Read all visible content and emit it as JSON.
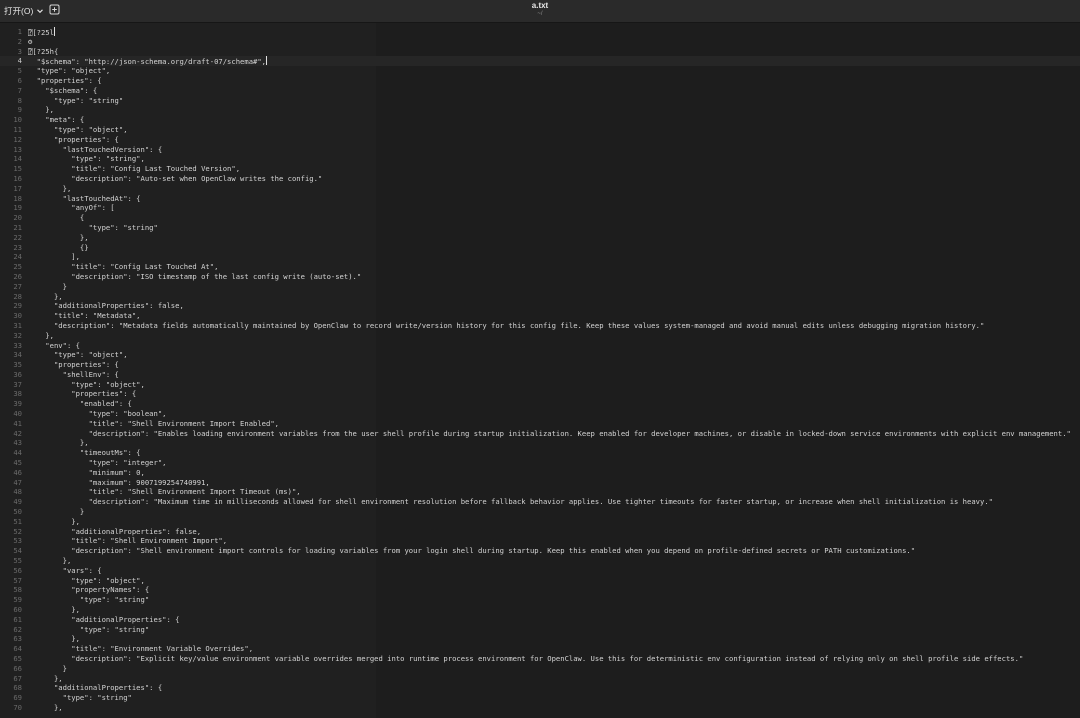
{
  "titlebar": {
    "open_label": "打开(O)",
    "title": "a.txt",
    "subtitle": "~/"
  },
  "icons": {
    "open_menu": "chevron-down-icon",
    "new_tab": "new-tab-icon"
  },
  "editor": {
    "current_line": 4,
    "lines": [
      "⍰[?25l",
      "⚙",
      "⍰[?25h{",
      "  \"$schema\": \"http://json-schema.org/draft-07/schema#\",",
      "  \"type\": \"object\",",
      "  \"properties\": {",
      "    \"$schema\": {",
      "      \"type\": \"string\"",
      "    },",
      "    \"meta\": {",
      "      \"type\": \"object\",",
      "      \"properties\": {",
      "        \"lastTouchedVersion\": {",
      "          \"type\": \"string\",",
      "          \"title\": \"Config Last Touched Version\",",
      "          \"description\": \"Auto-set when OpenClaw writes the config.\"",
      "        },",
      "        \"lastTouchedAt\": {",
      "          \"anyOf\": [",
      "            {",
      "              \"type\": \"string\"",
      "            },",
      "            {}",
      "          ],",
      "          \"title\": \"Config Last Touched At\",",
      "          \"description\": \"ISO timestamp of the last config write (auto-set).\"",
      "        }",
      "      },",
      "      \"additionalProperties\": false,",
      "      \"title\": \"Metadata\",",
      "      \"description\": \"Metadata fields automatically maintained by OpenClaw to record write/version history for this config file. Keep these values system-managed and avoid manual edits unless debugging migration history.\"",
      "    },",
      "    \"env\": {",
      "      \"type\": \"object\",",
      "      \"properties\": {",
      "        \"shellEnv\": {",
      "          \"type\": \"object\",",
      "          \"properties\": {",
      "            \"enabled\": {",
      "              \"type\": \"boolean\",",
      "              \"title\": \"Shell Environment Import Enabled\",",
      "              \"description\": \"Enables loading environment variables from the user shell profile during startup initialization. Keep enabled for developer machines, or disable in locked-down service environments with explicit env management.\"",
      "            },",
      "            \"timeoutMs\": {",
      "              \"type\": \"integer\",",
      "              \"minimum\": 0,",
      "              \"maximum\": 9007199254740991,",
      "              \"title\": \"Shell Environment Import Timeout (ms)\",",
      "              \"description\": \"Maximum time in milliseconds allowed for shell environment resolution before fallback behavior applies. Use tighter timeouts for faster startup, or increase when shell initialization is heavy.\"",
      "            }",
      "          },",
      "          \"additionalProperties\": false,",
      "          \"title\": \"Shell Environment Import\",",
      "          \"description\": \"Shell environment import controls for loading variables from your login shell during startup. Keep this enabled when you depend on profile-defined secrets or PATH customizations.\"",
      "        },",
      "        \"vars\": {",
      "          \"type\": \"object\",",
      "          \"propertyNames\": {",
      "            \"type\": \"string\"",
      "          },",
      "          \"additionalProperties\": {",
      "            \"type\": \"string\"",
      "          },",
      "          \"title\": \"Environment Variable Overrides\",",
      "          \"description\": \"Explicit key/value environment variable overrides merged into runtime process environment for OpenClaw. Use this for deterministic env configuration instead of relying only on shell profile side effects.\"",
      "        }",
      "      },",
      "      \"additionalProperties\": {",
      "        \"type\": \"string\"",
      "      },"
    ]
  }
}
